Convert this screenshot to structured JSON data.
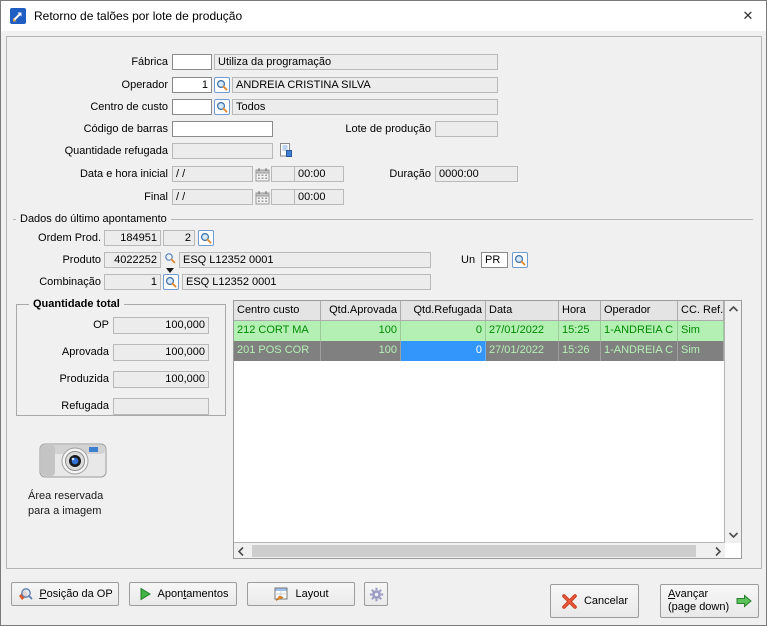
{
  "window": {
    "title": "Retorno de talões por lote de produção",
    "close_glyph": "✕"
  },
  "form": {
    "fabrica": {
      "label": "Fábrica",
      "value": "",
      "desc": "Utiliza da programação"
    },
    "operador": {
      "label": "Operador",
      "value": "1",
      "desc": "ANDREIA CRISTINA SILVA"
    },
    "centro_custo": {
      "label": "Centro de custo",
      "value": "",
      "desc": "Todos"
    },
    "codigo_barras": {
      "label": "Código de barras",
      "value": ""
    },
    "lote_producao": {
      "label": "Lote de produção",
      "value": ""
    },
    "quantidade_refugada": {
      "label": "Quantidade refugada",
      "value": ""
    },
    "data_hora_inicial": {
      "label": "Data e hora inicial",
      "date": "/ /",
      "extra": "",
      "time": "00:00"
    },
    "duracao": {
      "label": "Duração",
      "value": "0000:00"
    },
    "final": {
      "label": "Final",
      "date": "/ /",
      "extra": "",
      "time": "00:00"
    }
  },
  "apontamento": {
    "group_title": "Dados do último apontamento",
    "ordem": {
      "label": "Ordem Prod.",
      "value": "184951",
      "seq": "2"
    },
    "produto": {
      "label": "Produto",
      "value": "4022252",
      "desc": "ESQ L12352 0001"
    },
    "un": {
      "label": "Un",
      "value": "PR"
    },
    "combinacao": {
      "label": "Combinação",
      "value": "1",
      "desc": "ESQ L12352 0001"
    }
  },
  "quantidade_total": {
    "group_title": "Quantidade total",
    "op": {
      "label": "OP",
      "value": "100,000"
    },
    "aprovada": {
      "label": "Aprovada",
      "value": "100,000"
    },
    "produzida": {
      "label": "Produzida",
      "value": "100,000"
    },
    "refugada": {
      "label": "Refugada",
      "value": ""
    }
  },
  "image_area": {
    "line1": "Área reservada",
    "line2": "para a imagem"
  },
  "table": {
    "columns": [
      "Centro custo",
      "Qtd.Aprovada",
      "Qtd.Refugada",
      "Data",
      "Hora",
      "Operador",
      "CC. Ref."
    ],
    "rows": [
      {
        "centro_custo": "212 CORT MA",
        "qtd_aprovada": "100",
        "qtd_refugada": "0",
        "data": "27/01/2022",
        "hora": "15:25",
        "operador": "1-ANDREIA C",
        "cc_ref": "Sim"
      },
      {
        "centro_custo": "201 POS COR",
        "qtd_aprovada": "100",
        "qtd_refugada": "0",
        "data": "27/01/2022",
        "hora": "15:26",
        "operador": "1-ANDREIA C",
        "cc_ref": "Sim"
      }
    ]
  },
  "footer": {
    "posicao": {
      "underline": "P",
      "rest": "osição da OP"
    },
    "apontamentos": {
      "pre": "Apon",
      "underline": "t",
      "rest": "amentos"
    },
    "layout": {
      "label": "Layout"
    },
    "cancelar": {
      "label": "Cancelar"
    },
    "avancar": {
      "underline": "A",
      "rest": "vançar",
      "line2": "(page down)"
    }
  },
  "colors": {
    "row_green_bg": "#b4f0b4",
    "row_green_text": "#008a00",
    "row_selected_bg": "#808080",
    "row_selected_text": "#b4f0b4",
    "cell_focus_bg": "#3296fa",
    "cell_focus_text": "#ffffff"
  }
}
